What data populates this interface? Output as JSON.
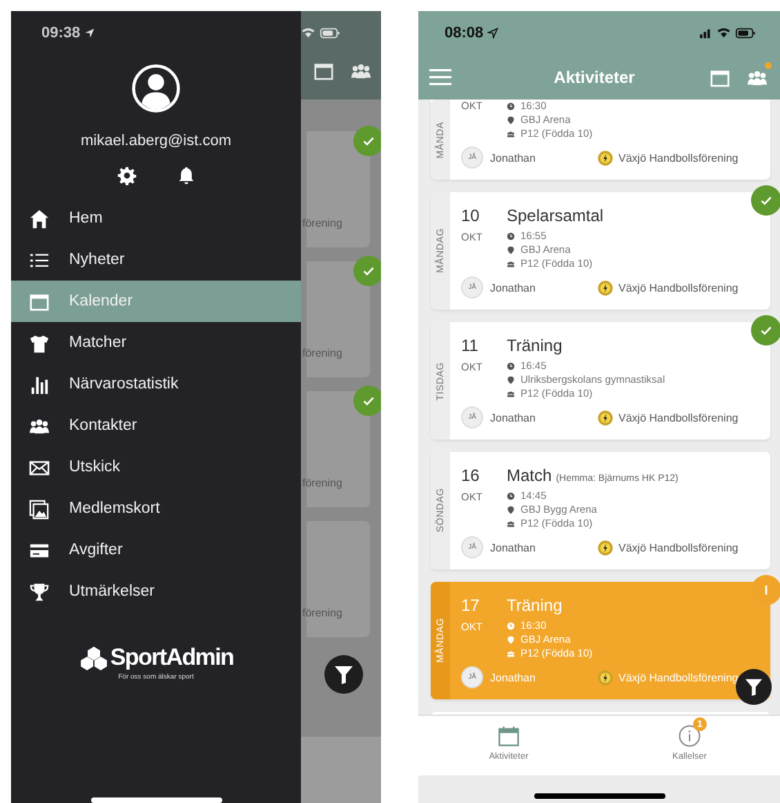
{
  "left_phone": {
    "status_bar": {
      "time": "09:38"
    },
    "drawer": {
      "email": "mikael.aberg@ist.com",
      "menu": [
        {
          "label": "Hem",
          "selected": false
        },
        {
          "label": "Nyheter",
          "selected": false
        },
        {
          "label": "Kalender",
          "selected": true
        },
        {
          "label": "Matcher",
          "selected": false
        },
        {
          "label": "Närvarostatistik",
          "selected": false
        },
        {
          "label": "Kontakter",
          "selected": false
        },
        {
          "label": "Utskick",
          "selected": false
        },
        {
          "label": "Medlemskort",
          "selected": false
        },
        {
          "label": "Avgifter",
          "selected": false
        },
        {
          "label": "Utmärkelser",
          "selected": false
        }
      ],
      "logo": {
        "name": "SportAdmin",
        "tagline": "För oss som älskar sport"
      }
    },
    "background_cards": [
      {
        "text": "förening",
        "confirmed": true
      },
      {
        "text": "förening",
        "confirmed": true
      },
      {
        "text": "förening",
        "confirmed": true
      },
      {
        "text": "förening",
        "confirmed": false
      }
    ]
  },
  "right_phone": {
    "status_bar": {
      "time": "08:08"
    },
    "header": {
      "title": "Aktiviteter",
      "notification_dot": true
    },
    "cards": [
      {
        "day": "MÅNDA",
        "month": "OKT",
        "time": "16:30",
        "place": "GBJ Arena",
        "group": "P12 (Födda 10)",
        "avatar": "JÅ",
        "person": "Jonathan",
        "club": "Växjö Handbollsförening",
        "confirmed": false,
        "pending": false
      },
      {
        "day": "MÅNDAG",
        "date": "10",
        "month": "OKT",
        "title": "Spelarsamtal",
        "time": "16:55",
        "place": "GBJ Arena",
        "group": "P12 (Födda 10)",
        "avatar": "JÅ",
        "person": "Jonathan",
        "club": "Växjö Handbollsförening",
        "confirmed": true,
        "pending": false
      },
      {
        "day": "TISDAG",
        "date": "11",
        "month": "OKT",
        "title": "Träning",
        "time": "16:45",
        "place": "Ulriksbergskolans gymnastiksal",
        "group": "P12 (Födda 10)",
        "avatar": "JÅ",
        "person": "Jonathan",
        "club": "Växjö Handbollsförening",
        "confirmed": true,
        "pending": false
      },
      {
        "day": "SÖNDAG",
        "date": "16",
        "month": "OKT",
        "title": "Match",
        "note": "(Hemma: Bjärnums HK P12)",
        "time": "14:45",
        "place": "GBJ Bygg Arena",
        "group": "P12 (Födda 10)",
        "avatar": "JÅ",
        "person": "Jonathan",
        "club": "Växjö Handbollsförening",
        "confirmed": false,
        "pending": false
      },
      {
        "day": "MÅNDAG",
        "date": "17",
        "month": "OKT",
        "title": "Träning",
        "time": "16:30",
        "place": "GBJ Arena",
        "group": "P12 (Födda 10)",
        "avatar": "JÅ",
        "person": "Jonathan",
        "club": "Växjö Handbollsförening",
        "confirmed": false,
        "pending": true
      }
    ],
    "tabs": [
      {
        "label": "Aktiviteter",
        "selected": true
      },
      {
        "label": "Kallelser",
        "selected": false,
        "badge": "1"
      }
    ]
  }
}
